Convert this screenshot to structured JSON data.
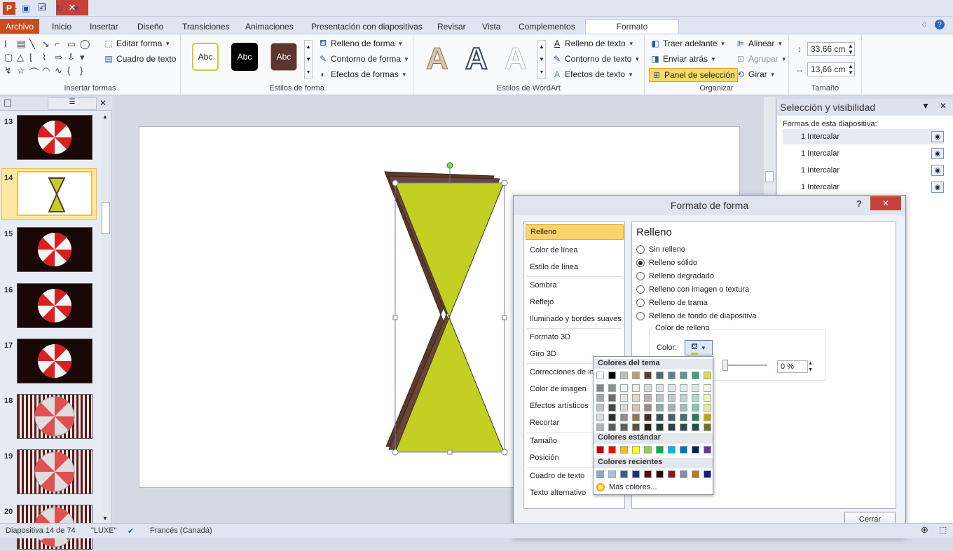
{
  "quick_access": {
    "app_icon": "powerpoint-icon",
    "save": "save-icon",
    "undo": "undo-icon",
    "redo": "redo-icon"
  },
  "tabs": [
    "Archivo",
    "Inicio",
    "Insertar",
    "Diseño",
    "Transiciones",
    "Animaciones",
    "Presentación con diapositivas",
    "Revisar",
    "Vista",
    "Complementos",
    "Formato"
  ],
  "ribbon": {
    "insert_shapes": {
      "edit_shape": "Editar forma",
      "text_box": "Cuadro de texto",
      "label": "Insertar formas"
    },
    "shape_styles": {
      "samples": [
        "Abc",
        "Abc",
        "Abc"
      ],
      "fill": "Relleno de forma",
      "outline": "Contorno de forma",
      "effects": "Efectos de formas",
      "label": "Estilos de forma"
    },
    "wordart": {
      "samples": [
        "A",
        "A",
        "A"
      ],
      "text_fill": "Relleno de texto",
      "text_outline": "Contorno de texto",
      "text_effects": "Efectos de texto",
      "label": "Estilos de WordArt"
    },
    "arrange": {
      "bring_forward": "Traer adelante",
      "send_back": "Enviar atrás",
      "selection_pane": "Panel de selección",
      "align": "Alinear",
      "group": "Agrupar",
      "rotate": "Girar",
      "label": "Organizar"
    },
    "size": {
      "height": "33,66 cm",
      "width": "13,66 cm",
      "label": "Tamaño"
    }
  },
  "thumbnails": [
    "13",
    "14",
    "15",
    "16",
    "17",
    "18",
    "19",
    "20"
  ],
  "selection_pane": {
    "title": "Selección y visibilidad",
    "subtitle": "Formas de esta diapositiva:",
    "items": [
      "1 Intercalar",
      "1 Intercalar",
      "1 Intercalar",
      "1 Intercalar"
    ]
  },
  "dialog": {
    "title": "Formato de forma",
    "help": "?",
    "categories": [
      "Relleno",
      "Color de línea",
      "Estilo de línea",
      "Sombra",
      "Reflejo",
      "Iluminado y bordes suaves",
      "Formato 3D",
      "Giro 3D",
      "Correcciones de ima",
      "Color de imagen",
      "Efectos artísticos",
      "Recortar",
      "Tamaño",
      "Posición",
      "Cuadro de texto",
      "Texto alternativo"
    ],
    "heading": "Relleno",
    "options": [
      "Sin relleno",
      "Relleno sólido",
      "Relleno degradado",
      "Relleno con imagen o textura",
      "Relleno de trama",
      "Relleno de fondo de diapositiva"
    ],
    "selected_option": "Relleno sólido",
    "fill_color_group": "Color de relleno",
    "color_label": "Color:",
    "transparency": "0 %",
    "close": "Cerrar"
  },
  "palette": {
    "theme_title": "Colores del tema",
    "standard_title": "Colores estándar",
    "recent_title": "Colores recientes",
    "more": "Más colores...",
    "theme_top": [
      "#ffffff",
      "#000000",
      "#c0bcb6",
      "#c49a6c",
      "#5c3c33",
      "#4f6b7a",
      "#5f7f8e",
      "#6a8e98",
      "#3e9e7f",
      "#d4e04a"
    ],
    "standard": [
      "#c00000",
      "#ff0000",
      "#ffc000",
      "#ffff00",
      "#92d050",
      "#00b050",
      "#00b0f0",
      "#0070c0",
      "#002060",
      "#7030a0"
    ],
    "recent": [
      "#8fa8c8",
      "#b0bfd3",
      "#3b5a8a",
      "#1f2f7a",
      "#5a0a0a",
      "#3a0000",
      "#a01010",
      "#8a8aa8",
      "#c07a10",
      "#1a1a80"
    ]
  },
  "status": {
    "slide": "Diapositiva 14 de 74",
    "theme": "\"LUXE\"",
    "language": "Francés (Canadá)"
  }
}
